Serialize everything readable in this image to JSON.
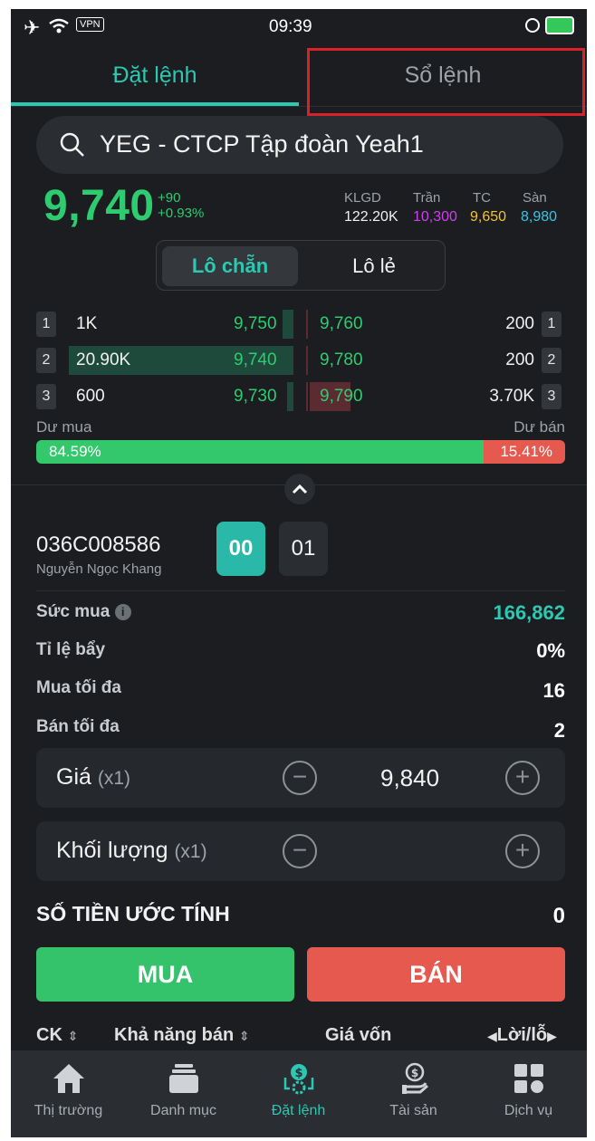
{
  "status": {
    "vpn": "VPN",
    "time": "09:39"
  },
  "tabs": [
    {
      "label": "Đặt lệnh"
    },
    {
      "label": "Sổ lệnh"
    }
  ],
  "search": {
    "text": "YEG - CTCP Tập đoàn Yeah1"
  },
  "quote": {
    "price": "9,740",
    "change": "+90",
    "change_pct": "+0.93%",
    "klgd_label": "KLGD",
    "klgd": "122.20K",
    "tran_label": "Trần",
    "tran": "10,300",
    "tc_label": "TC",
    "tc": "9,650",
    "san_label": "Sàn",
    "san": "8,980"
  },
  "lot_toggle": {
    "even": "Lô chẵn",
    "odd": "Lô lẻ"
  },
  "orderbook": [
    {
      "idx": "1",
      "bid_vol": "1K",
      "bid_price": "9,750",
      "ask_price": "9,760",
      "ask_vol": "200",
      "bid_share": 0.05,
      "ask_share": 0.0
    },
    {
      "idx": "2",
      "bid_vol": "20.90K",
      "bid_price": "9,740",
      "ask_price": "9,780",
      "ask_vol": "200",
      "bid_share": 1.0,
      "ask_share": 0.0
    },
    {
      "idx": "3",
      "bid_vol": "600",
      "bid_price": "9,730",
      "ask_price": "9,790",
      "ask_vol": "3.70K",
      "bid_share": 0.03,
      "ask_share": 0.18
    }
  ],
  "depth": {
    "buy_label": "Dư mua",
    "sell_label": "Dư bán",
    "buy_pct": "84.59%",
    "sell_pct": "15.41%",
    "buy_fraction": 0.8459
  },
  "account": {
    "number": "036C008586",
    "name": "Nguyễn Ngọc Khang",
    "sub1": "00",
    "sub2": "01"
  },
  "info": [
    {
      "label": "Sức mua",
      "value": "166,862"
    },
    {
      "label": "Tỉ lệ bẩy",
      "value": "0%"
    },
    {
      "label": "Mua tối đa",
      "value": "16"
    },
    {
      "label": "Bán tối đa",
      "value": "2"
    }
  ],
  "price_input": {
    "label": "Giá",
    "mult": "(x1)",
    "value": "9,840"
  },
  "qty_input": {
    "label": "Khối lượng",
    "mult": "(x1)",
    "value": ""
  },
  "estimate": {
    "label": "SỐ TIỀN ƯỚC TÍNH",
    "value": "0"
  },
  "actions": {
    "buy": "MUA",
    "sell": "BÁN"
  },
  "holdings_header": {
    "ck": "CK",
    "kha_nang_ban": "Khả năng bán",
    "gia_von": "Giá vốn",
    "loi_lo": "Lời/lỗ"
  },
  "nav": [
    {
      "label": "Thị trường",
      "icon": "home-icon"
    },
    {
      "label": "Danh mục",
      "icon": "portfolio-icon"
    },
    {
      "label": "Đặt lệnh",
      "icon": "place-order-icon"
    },
    {
      "label": "Tài sản",
      "icon": "assets-icon"
    },
    {
      "label": "Dịch vụ",
      "icon": "services-icon"
    }
  ],
  "colors": {
    "accent": "#2dc8b2",
    "up": "#2ecc71",
    "down": "#e5594f",
    "ceiling": "#d13df0",
    "ref": "#f2c230",
    "floor": "#36c6e8"
  }
}
